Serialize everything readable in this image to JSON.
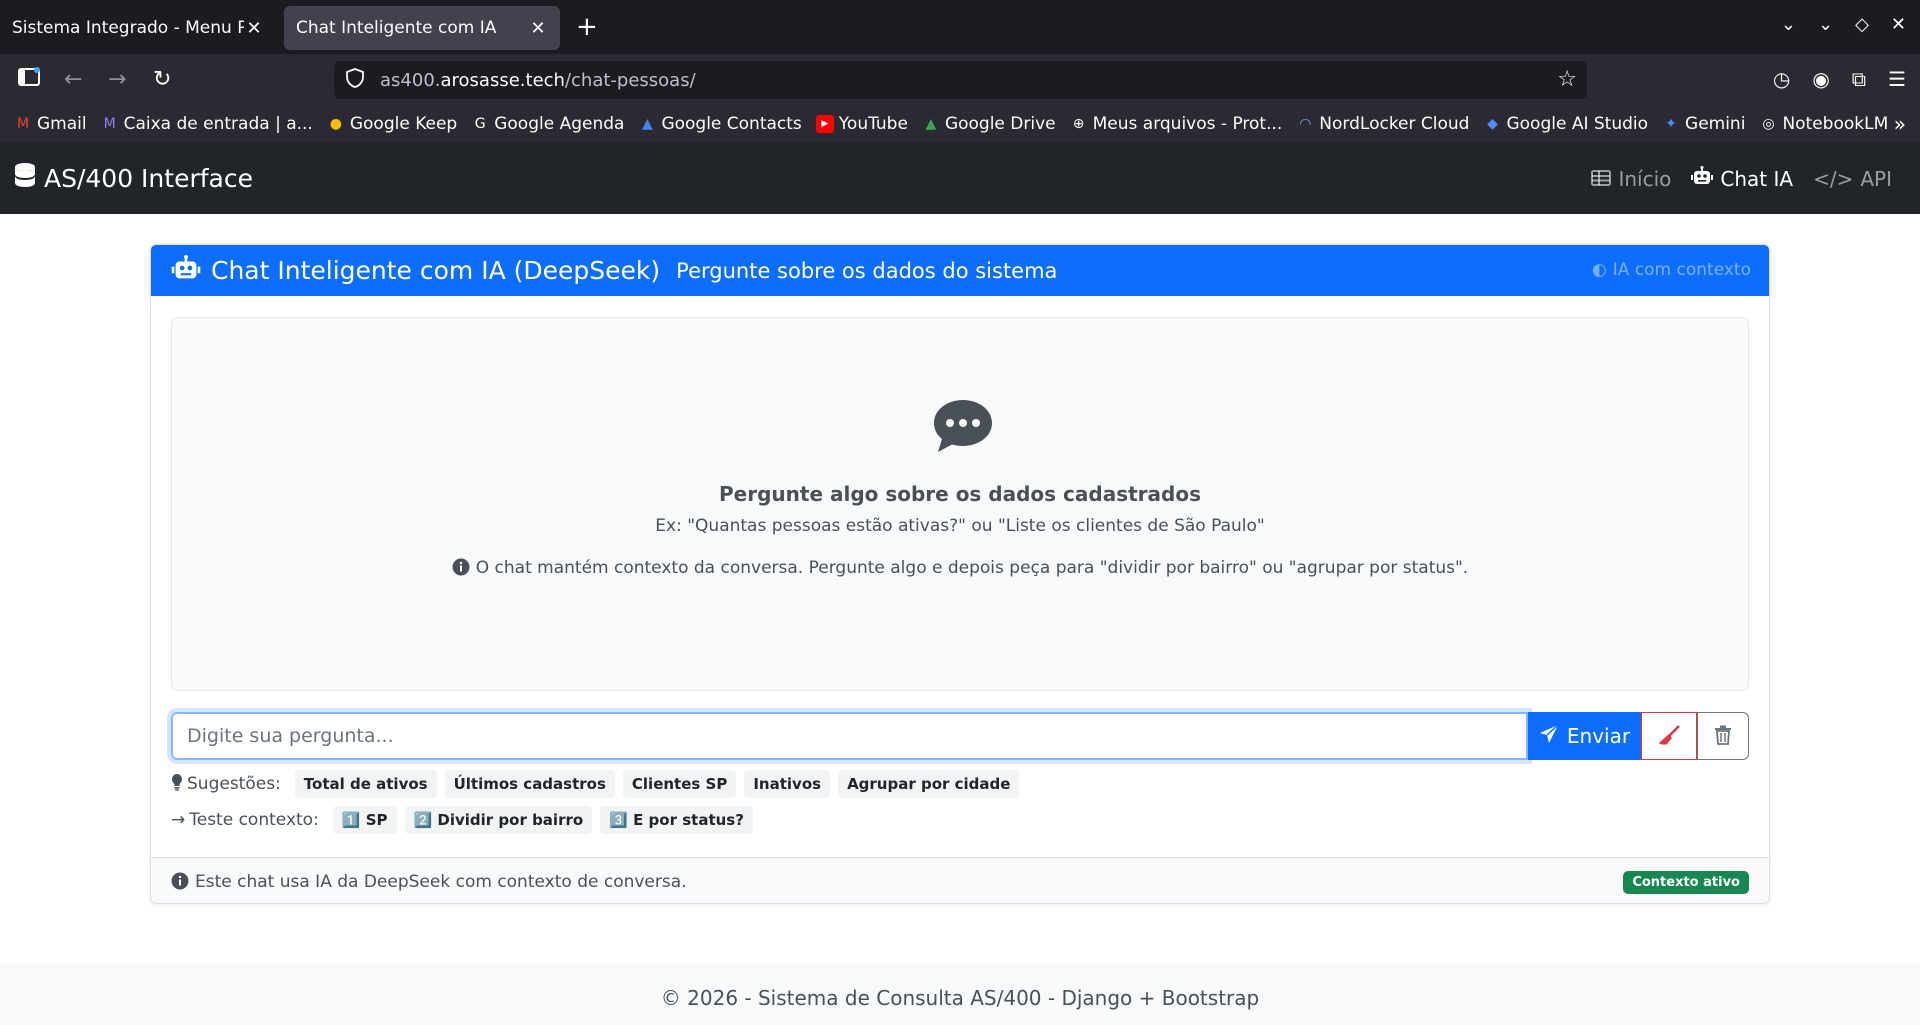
{
  "browser": {
    "tabs": [
      {
        "title": "Sistema Integrado - Menu Principal",
        "active": false
      },
      {
        "title": "Chat Inteligente com IA",
        "active": true
      }
    ],
    "url": {
      "host_prefix": "as400.",
      "host_domain": "arosasse.tech",
      "path": "/chat-pessoas/"
    },
    "bookmarks": [
      {
        "label": "Gmail",
        "icon": "gmail-icon",
        "color": "#ea4335"
      },
      {
        "label": "Caixa de entrada | a...",
        "icon": "proton-mail-icon",
        "color": "#8b7cf6"
      },
      {
        "label": "Google Keep",
        "icon": "google-keep-icon",
        "color": "#fbbc04"
      },
      {
        "label": "Google Agenda",
        "icon": "google-icon",
        "color": "#ffffff"
      },
      {
        "label": "Google Contacts",
        "icon": "google-contacts-icon",
        "color": "#4285f4"
      },
      {
        "label": "YouTube",
        "icon": "youtube-icon",
        "color": "#ff0000"
      },
      {
        "label": "Google Drive",
        "icon": "google-drive-icon",
        "color": "#34a853"
      },
      {
        "label": "Meus arquivos - Prot...",
        "icon": "globe-icon",
        "color": "#fbfbfe"
      },
      {
        "label": "NordLocker Cloud",
        "icon": "nordlocker-icon",
        "color": "#7aa2ff"
      },
      {
        "label": "Google AI Studio",
        "icon": "ai-studio-icon",
        "color": "#4f8ef7"
      },
      {
        "label": "Gemini",
        "icon": "gemini-icon",
        "color": "#4f8ef7"
      },
      {
        "label": "NotebookLM",
        "icon": "notebooklm-icon",
        "color": "#ffffff"
      }
    ]
  },
  "app": {
    "brand": "AS/400 Interface",
    "nav": [
      {
        "label": "Início",
        "active": false
      },
      {
        "label": "Chat IA",
        "active": true
      },
      {
        "label": "API",
        "active": false
      }
    ]
  },
  "card": {
    "title": "Chat Inteligente com IA (DeepSeek)",
    "subtitle": "Pergunte sobre os dados do sistema",
    "context_note": "IA com contexto",
    "empty_title": "Pergunte algo sobre os dados cadastrados",
    "empty_example": "Ex: \"Quantas pessoas estão ativas?\" ou \"Liste os clientes de São Paulo\"",
    "empty_info": "O chat mantém contexto da conversa. Pergunte algo e depois peça para \"dividir por bairro\" ou \"agrupar por status\".",
    "input_placeholder": "Digite sua pergunta...",
    "send_label": "Enviar",
    "suggestions_label": "Sugestões:",
    "suggestions": [
      "Total de ativos",
      "Últimos cadastros",
      "Clientes SP",
      "Inativos",
      "Agrupar por cidade"
    ],
    "context_test_label": "Teste contexto:",
    "context_tests": [
      "1️⃣ SP",
      "2️⃣ Dividir por bairro",
      "3️⃣ E por status?"
    ],
    "footer_text": "Este chat usa IA da DeepSeek com contexto de conversa.",
    "badge": "Contexto ativo"
  },
  "footer": {
    "text": "© 2026 - Sistema de Consulta AS/400 - Django + Bootstrap"
  },
  "colors": {
    "primary": "#0d6efd",
    "dark": "#212529",
    "success": "#198754",
    "danger": "#dc3545"
  }
}
